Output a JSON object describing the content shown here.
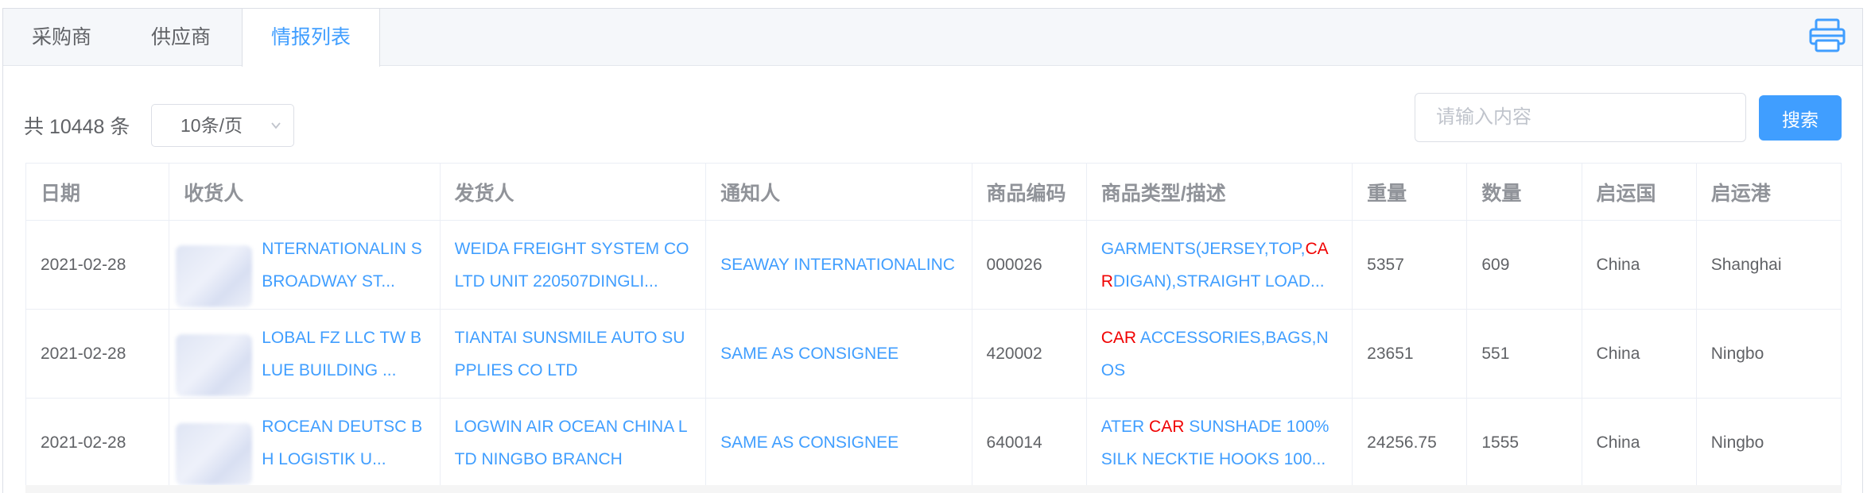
{
  "tabs": [
    {
      "label": "采购商"
    },
    {
      "label": "供应商"
    },
    {
      "label": "情报列表"
    }
  ],
  "toolbar": {
    "total_text": "共 10448 条",
    "page_size": "10条/页",
    "search_placeholder": "请输入内容",
    "search_label": "搜索"
  },
  "table": {
    "headers": [
      "日期",
      "收货人",
      "发货人",
      "通知人",
      "商品编码",
      "商品类型/描述",
      "重量",
      "数量",
      "启运国",
      "启运港"
    ],
    "rows": [
      {
        "date": "2021-02-28",
        "consignee": "NTERNATIONALIN S BROADWAY ST...",
        "shipper": "WEIDA FREIGHT SYSTEM CO LTD UNIT 220507DINGLI...",
        "notify": "SEAWAY INTERNATIONALINC",
        "hs_code": "000026",
        "desc_pre": "GARMENTS(JERSEY,TOP,",
        "desc_hl": "CAR",
        "desc_post": "DIGAN),STRAIGHT LOAD...",
        "weight": "5357",
        "qty": "609",
        "country": "China",
        "port": "Shanghai"
      },
      {
        "date": "2021-02-28",
        "consignee": "LOBAL FZ LLC TW BLUE BUILDING ...",
        "shipper": "TIANTAI SUNSMILE AUTO SUPPLIES CO LTD",
        "notify": "SAME AS CONSIGNEE",
        "hs_code": "420002",
        "desc_pre": "",
        "desc_hl": "CAR",
        "desc_post": " ACCESSORIES,BAGS,NOS",
        "weight": "23651",
        "qty": "551",
        "country": "China",
        "port": "Ningbo"
      },
      {
        "date": "2021-02-28",
        "consignee": "ROCEAN DEUTSC BH LOGISTIK U...",
        "shipper": "LOGWIN AIR OCEAN CHINA LTD NINGBO BRANCH",
        "notify": "SAME AS CONSIGNEE",
        "hs_code": "640014",
        "desc_pre": "ATER ",
        "desc_hl": "CAR",
        "desc_post": " SUNSHADE 100% SILK NECKTIE HOOKS 100...",
        "weight": "24256.75",
        "qty": "1555",
        "country": "China",
        "port": "Ningbo"
      }
    ]
  },
  "colors": {
    "accent": "#409eff",
    "highlight": "#f00000"
  },
  "icons": {
    "print": "printer-icon",
    "select": "chevron-down-icon"
  }
}
